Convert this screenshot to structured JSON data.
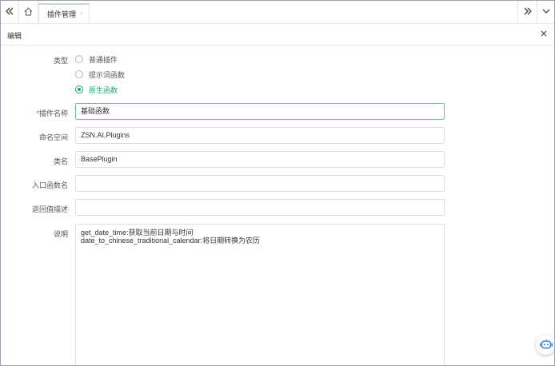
{
  "tabbar": {
    "icons": {
      "scroll_left": "double-chevron-left-icon",
      "home": "home-icon",
      "scroll_right": "double-chevron-right-icon",
      "more": "chevron-down-icon"
    },
    "active_tab": {
      "label": "插件管理",
      "close_glyph": "×"
    }
  },
  "panel": {
    "title": "编辑",
    "close_icon": "close-icon"
  },
  "form": {
    "type": {
      "label": "类型",
      "options": [
        {
          "label": "普通插件",
          "checked": false
        },
        {
          "label": "提示词函数",
          "checked": false
        },
        {
          "label": "原生函数",
          "checked": true
        }
      ]
    },
    "plugin_name": {
      "required_mark": "*",
      "label": "插件名称",
      "value": "基础函数"
    },
    "namespace": {
      "label": "命名空间",
      "value": "ZSN.AI.Plugins"
    },
    "class_name": {
      "label": "类名",
      "value": "BasePlugin"
    },
    "entry_function": {
      "label": "入口函数名",
      "value": ""
    },
    "return_desc": {
      "label": "返回值描述",
      "value": ""
    },
    "description": {
      "label": "说明",
      "lines": [
        "get_date_time:获取当前日期与时间",
        "date_to_chinese_traditional_calendar:将日期转换为农历"
      ]
    }
  },
  "assistant": {
    "icon": "robot-assistant-icon"
  },
  "colors": {
    "accent": "#19a974",
    "focus_border": "#68c7a6",
    "required": "#e5484d",
    "border": "#dcdfe4",
    "frame": "#9aa3ad",
    "fab_icon": "#3a7bd5"
  }
}
